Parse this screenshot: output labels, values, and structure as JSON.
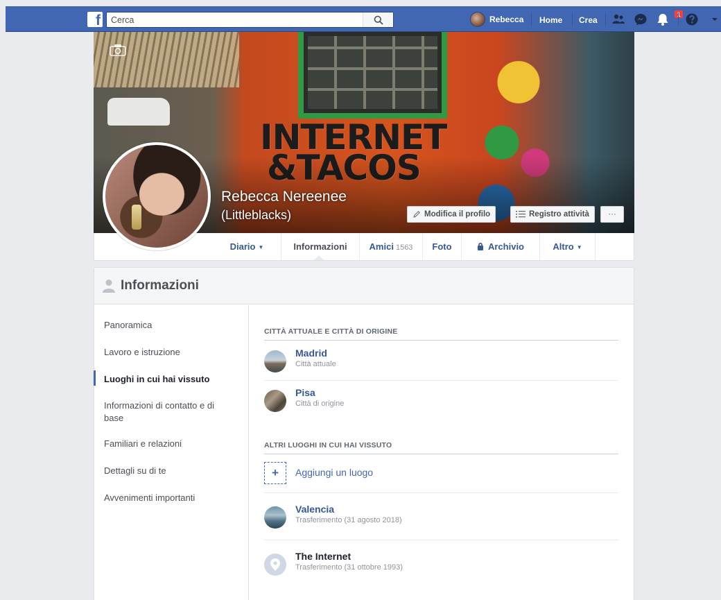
{
  "topbar": {
    "logo": "f",
    "search_placeholder": "Cerca",
    "user_name": "Rebecca",
    "home_label": "Home",
    "create_label": "Crea",
    "notification_count": "1",
    "icons": [
      "search-icon",
      "friends-icon",
      "messenger-icon",
      "notifications-icon",
      "help-icon",
      "dropdown-icon"
    ],
    "brand_color": "#4267b2"
  },
  "cover": {
    "mural_text_1": "INTERNET",
    "mural_text_2": "&TACOS",
    "name": "Rebecca Nereenee",
    "alt_name": "(Littleblacks)",
    "edit_profile_label": "Modifica il profilo",
    "activity_log_label": "Registro attività",
    "more_label": "···"
  },
  "tabs": {
    "timeline": "Diario",
    "about": "Informazioni",
    "friends": "Amici",
    "friends_count": "1563",
    "photos": "Foto",
    "archive": "Archivio",
    "more": "Altro"
  },
  "about": {
    "title": "Informazioni",
    "nav": [
      {
        "label": "Panoramica"
      },
      {
        "label": "Lavoro e istruzione"
      },
      {
        "label": "Luoghi in cui hai vissuto",
        "active": true
      },
      {
        "label": "Informazioni di contatto e di base"
      },
      {
        "label": "Familiari e relazioni"
      },
      {
        "label": "Dettagli su di te"
      },
      {
        "label": "Avvenimenti importanti"
      }
    ],
    "current_section_title": "CITTÀ ATTUALE E CITTÀ DI ORIGINE",
    "current_places": [
      {
        "name": "Madrid",
        "detail": "Città attuale"
      },
      {
        "name": "Pisa",
        "detail": "Città di origine"
      }
    ],
    "other_section_title": "ALTRI LUOGHI IN CUI HAI VISSUTO",
    "add_place_label": "Aggiungi un luogo",
    "other_places": [
      {
        "name": "Valencia",
        "detail": "Trasferimento (31 agosto 2018)"
      },
      {
        "name": "The Internet",
        "detail": "Trasferimento (31 ottobre 1993)"
      }
    ]
  }
}
